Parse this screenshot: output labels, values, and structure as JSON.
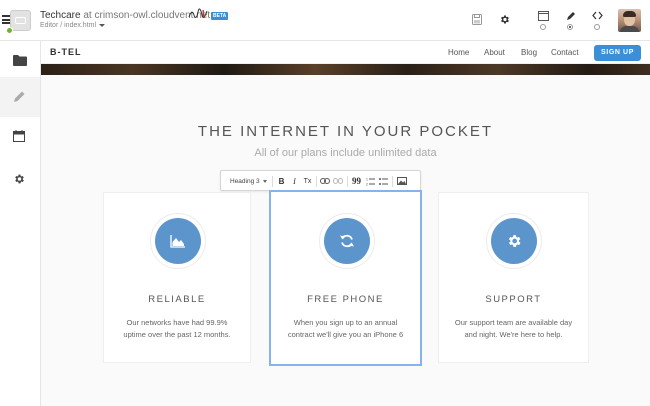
{
  "app": {
    "site_name": "Techcare",
    "at_word": "at",
    "host": "crimson-owl.cloudvent.net",
    "beta_label": "BETA",
    "breadcrumb": "Editor / index.html"
  },
  "website": {
    "brand": "B-TEL",
    "nav": [
      "Home",
      "About",
      "Blog",
      "Contact"
    ],
    "signup_label": "SIGN UP",
    "section_title": "THE INTERNET IN YOUR POCKET",
    "section_subtitle": "All of our plans include unlimited data",
    "cards": [
      {
        "title": "RELIABLE",
        "text": "Our networks have had 99.9% uptime over the past 12 months.",
        "icon": "chart-area-icon"
      },
      {
        "title": "FREE PHONE",
        "text": "When you sign up to an annual contract we'll give you an iPhone 6",
        "icon": "refresh-icon"
      },
      {
        "title": "SUPPORT",
        "text": "Our support team are available day and night. We're here to help.",
        "icon": "gear-icon"
      }
    ]
  },
  "editor_toolbar": {
    "format_value": "Heading 3",
    "bold": "B",
    "italic": "I",
    "clear": "Tx",
    "quote": "99"
  },
  "colors": {
    "accent": "#3a8fd6",
    "icon_circle": "#5c95cc",
    "selection": "#86b3ee",
    "status_green": "#6fb52c"
  }
}
